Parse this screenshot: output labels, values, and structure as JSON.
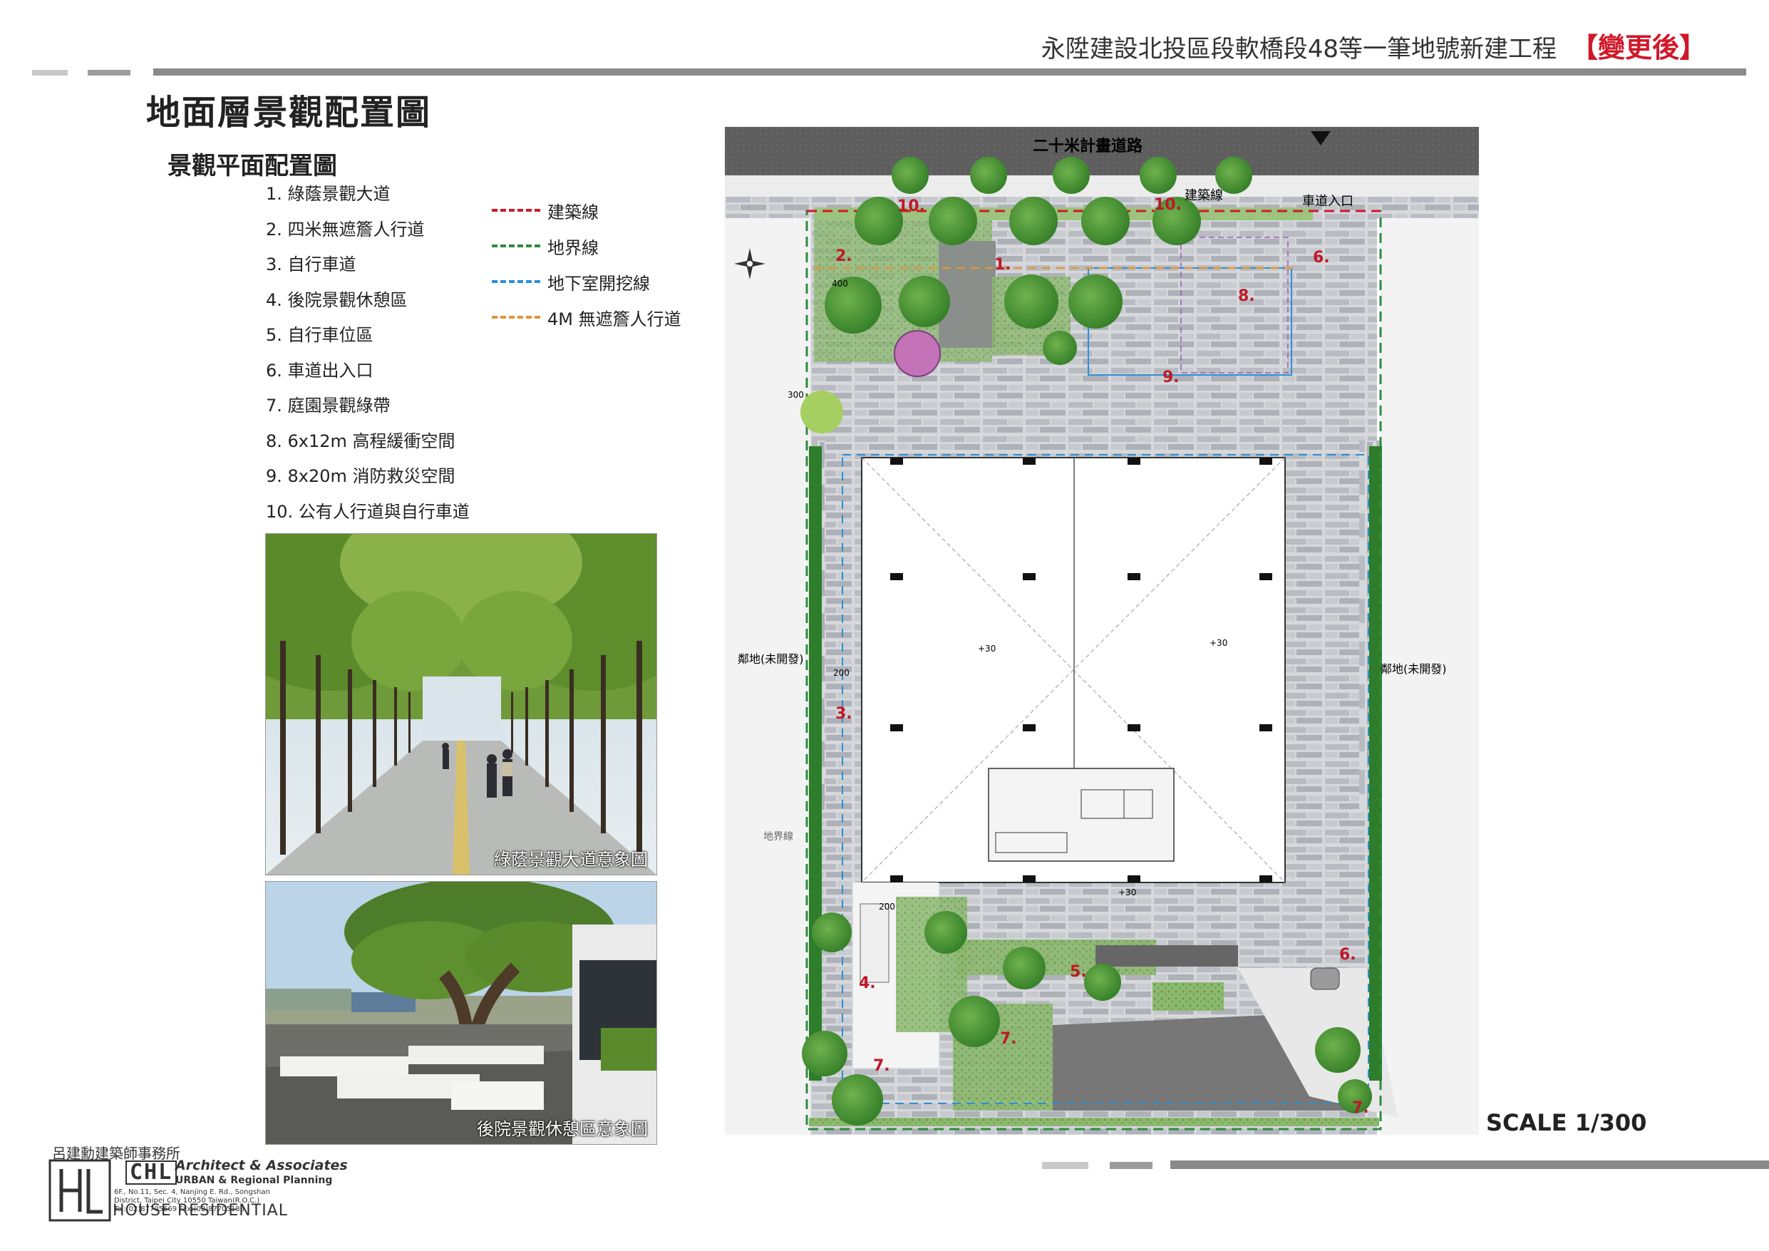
{
  "header": {
    "project_title": "永陞建設北投區段軟橋段48等一筆地號新建工程",
    "revision_tag": "【變更後】"
  },
  "page_title": "地面層景觀配置圖",
  "section_title": "景觀平面配置圖",
  "key_items": [
    "1. 綠蔭景觀大道",
    "2. 四米無遮簷人行道",
    "3. 自行車道",
    "4. 後院景觀休憩區",
    "5. 自行車位區",
    "6. 車道出入口",
    "7. 庭園景觀綠帶",
    "8. 6x12m 高程緩衝空間",
    "9. 8x20m 消防救災空間",
    "10. 公有人行道與自行車道"
  ],
  "legend": [
    {
      "label": "建築線",
      "color": "#d0182a"
    },
    {
      "label": "地界線",
      "color": "#2e8b3e"
    },
    {
      "label": "地下室開挖線",
      "color": "#2a8fd8"
    },
    {
      "label": "4M 無遮簷人行道",
      "color": "#e0963a"
    }
  ],
  "photos": [
    {
      "caption": "綠蔭景觀大道意象圖"
    },
    {
      "caption": "後院景觀休憩區意象圖"
    }
  ],
  "plan": {
    "road_label": "二十米計畫道路",
    "building_line_label": "建築線",
    "driveway_entry_label": "車道入口",
    "neighbor_left": "鄰地(未開發)",
    "neighbor_right": "鄰地(未開發)",
    "boundary_label": "地界線",
    "numbers": [
      "1.",
      "2.",
      "3.",
      "4.",
      "5.",
      "6.",
      "6.",
      "7.",
      "7.",
      "7.",
      "8.",
      "9.",
      "10.",
      "10."
    ],
    "elevation_main_1": "+30",
    "elevation_main_2": "+30",
    "elevation_lobby": "+30",
    "dim_400": "400",
    "dim_300": "300",
    "dim_200_a": "200",
    "dim_200_b": "200"
  },
  "scale_label": "SCALE 1/300",
  "firm": {
    "name_zh": "呂建勳建築師事務所",
    "logo_text": "CHL",
    "name_en_1": "Architect & Associates",
    "name_en_2": "URBAN & Regional Planning",
    "address": "6F., No.11, Sec. 4, Nanjing E. Rd., Songshan District, Taipei City 10550 Taiwan(R.O.C.)",
    "phone": "Tel:(02)87705669 Fax:(02)87705186",
    "tagline": "HOUSE RESIDENTIAL"
  },
  "colors": {
    "accent_red": "#d0182a",
    "tree_green": "#3f8f2e",
    "boundary_green": "#2e8b3e",
    "basement_blue": "#2a8fd8",
    "paving_gray": "#c9ccd0",
    "road_gray": "#6e6e6e"
  }
}
